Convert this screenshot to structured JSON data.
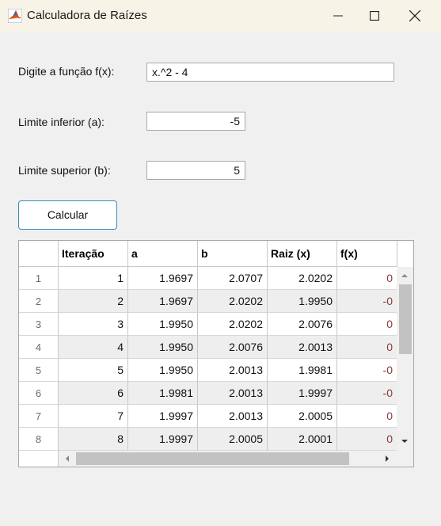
{
  "window": {
    "title": "Calculadora de Raízes",
    "icon": "matlab-icon",
    "controls": [
      "minimize-icon",
      "maximize-icon",
      "close-icon"
    ]
  },
  "form": {
    "func_label": "Digite a função f(x):",
    "func_value": "x.^2 - 4",
    "lower_label": "Limite inferior (a):",
    "lower_value": "-5",
    "upper_label": "Limite superior (b):",
    "upper_value": "5",
    "calc_label": "Calcular"
  },
  "table": {
    "columns": [
      "Iteração",
      "a",
      "b",
      "Raiz (x)",
      "f(x)"
    ],
    "rows": [
      {
        "n": "1",
        "it": "1",
        "a": "1.9697",
        "b": "2.0707",
        "x": "2.0202",
        "fx": "0"
      },
      {
        "n": "2",
        "it": "2",
        "a": "1.9697",
        "b": "2.0202",
        "x": "1.9950",
        "fx": "-0"
      },
      {
        "n": "3",
        "it": "3",
        "a": "1.9950",
        "b": "2.0202",
        "x": "2.0076",
        "fx": "0"
      },
      {
        "n": "4",
        "it": "4",
        "a": "1.9950",
        "b": "2.0076",
        "x": "2.0013",
        "fx": "0"
      },
      {
        "n": "5",
        "it": "5",
        "a": "1.9950",
        "b": "2.0013",
        "x": "1.9981",
        "fx": "-0"
      },
      {
        "n": "6",
        "it": "6",
        "a": "1.9981",
        "b": "2.0013",
        "x": "1.9997",
        "fx": "-0"
      },
      {
        "n": "7",
        "it": "7",
        "a": "1.9997",
        "b": "2.0013",
        "x": "2.0005",
        "fx": "0"
      },
      {
        "n": "8",
        "it": "8",
        "a": "1.9997",
        "b": "2.0005",
        "x": "2.0001",
        "fx": "0"
      }
    ]
  }
}
